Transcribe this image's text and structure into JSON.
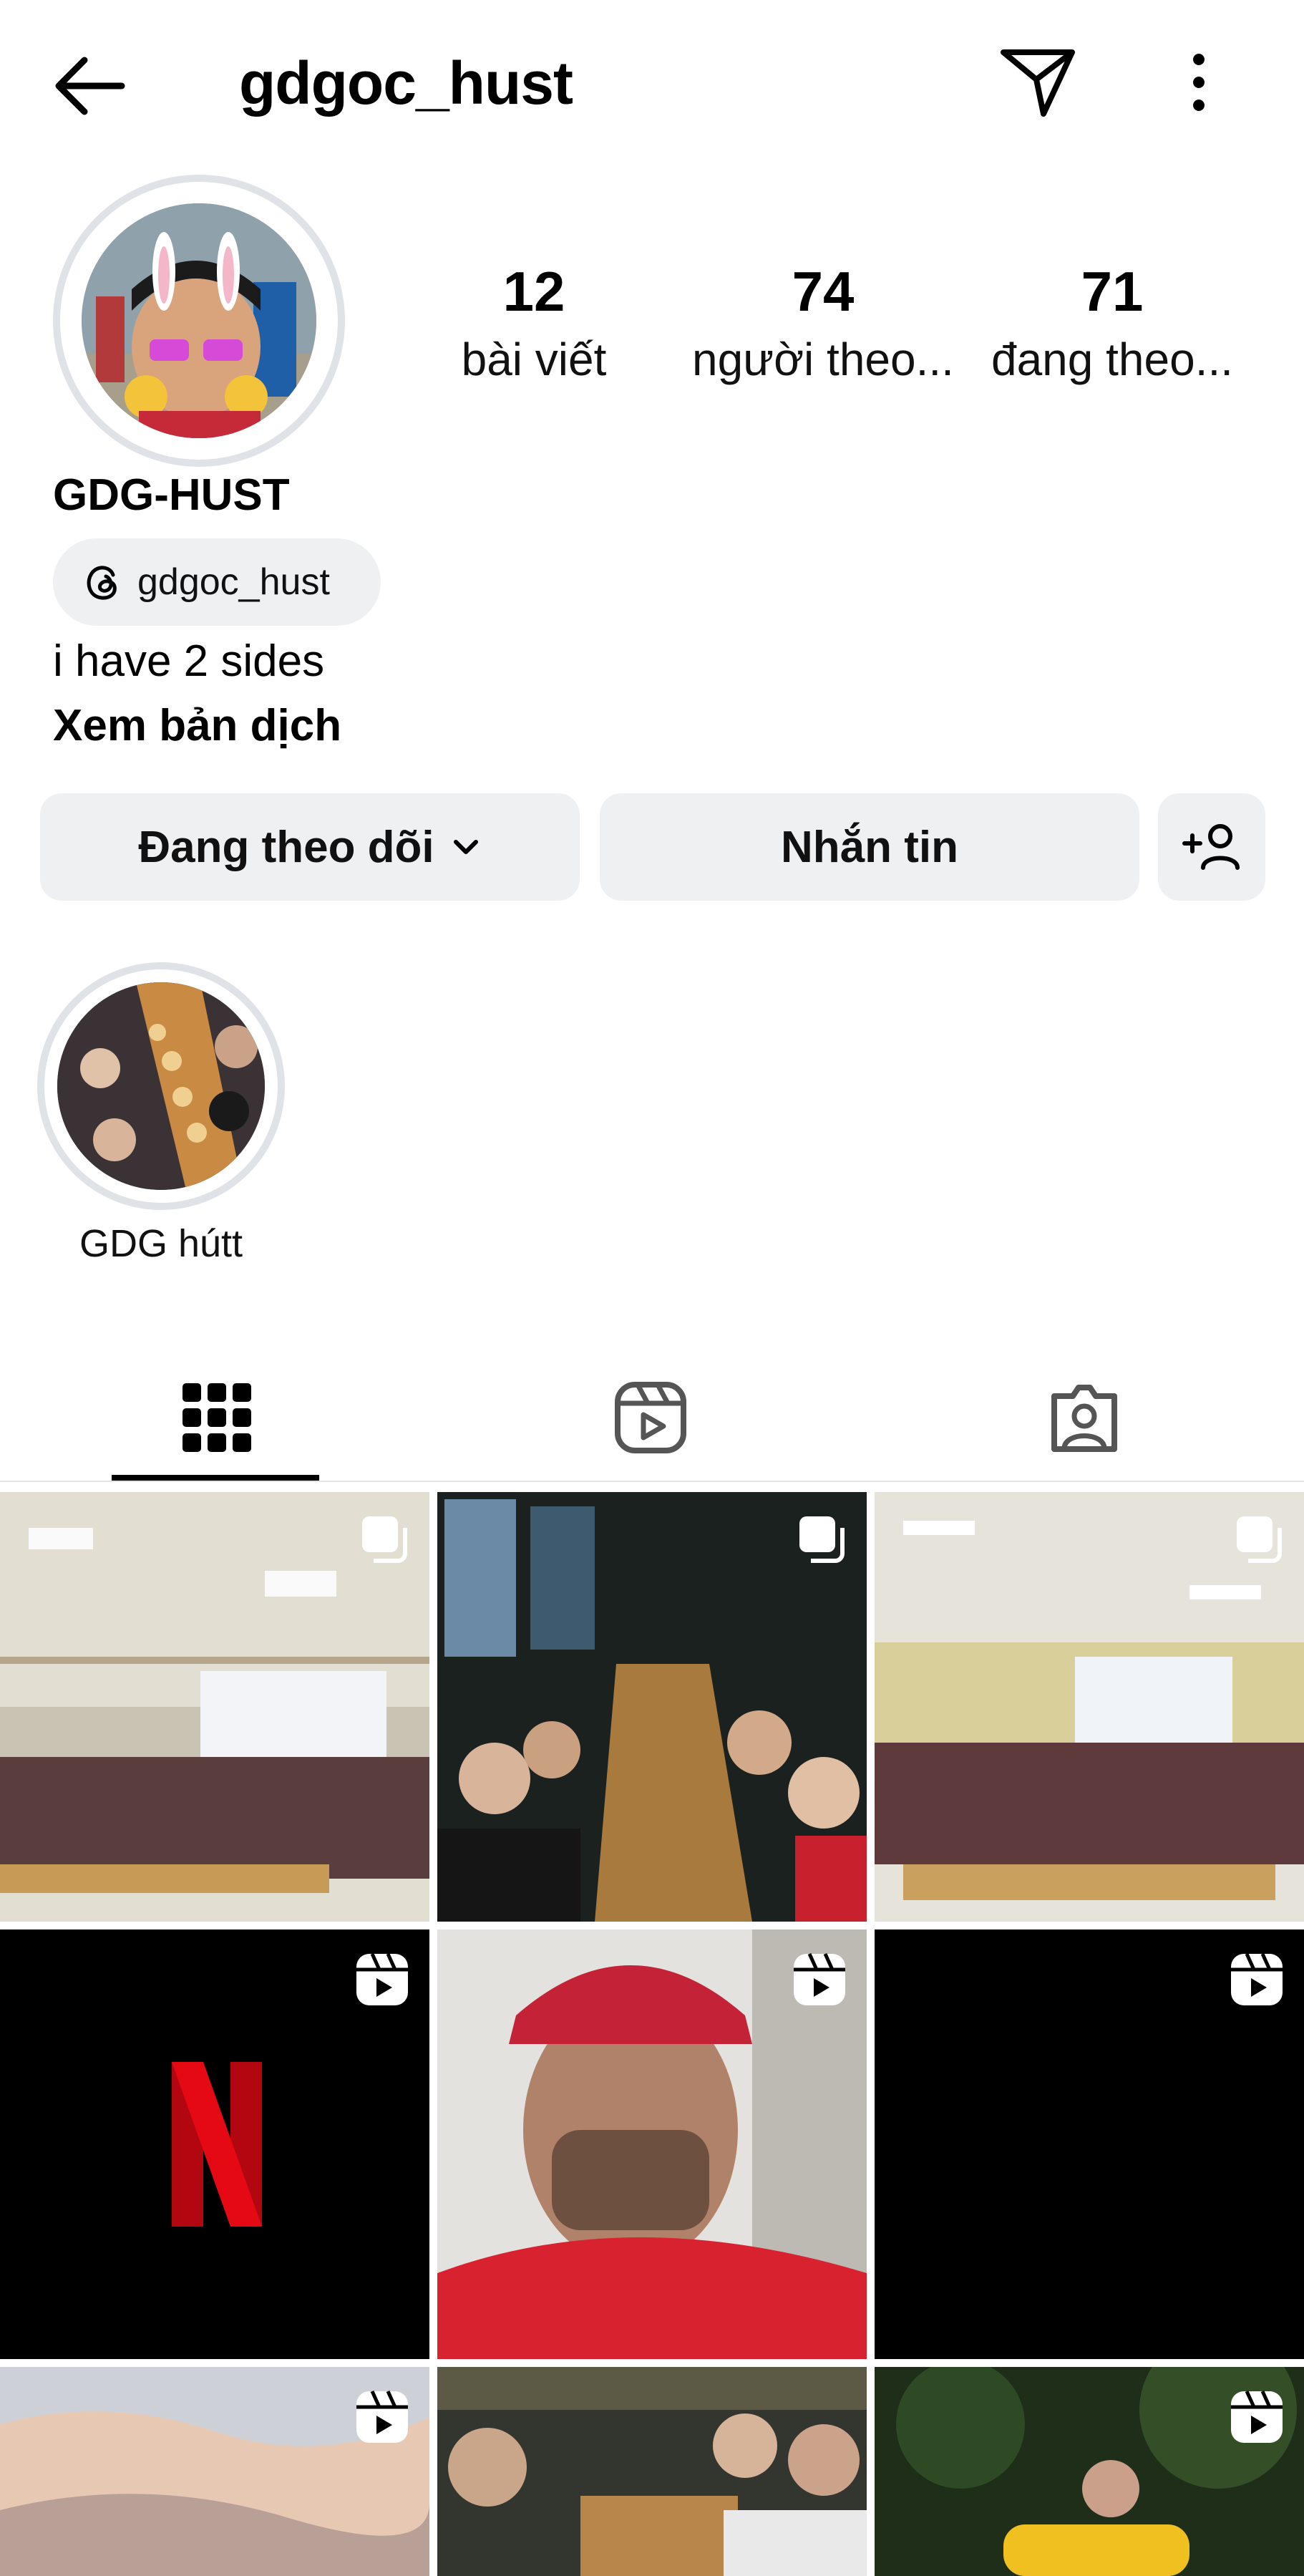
{
  "header": {
    "username": "gdgoc_hust"
  },
  "profile": {
    "stats": [
      {
        "value": "12",
        "label": "bài viết"
      },
      {
        "value": "74",
        "label": "người theo..."
      },
      {
        "value": "71",
        "label": "đang theo..."
      }
    ],
    "display_name": "GDG-HUST",
    "threads_handle": "gdgoc_hust",
    "bio": "i have 2 sides",
    "translate_link": "Xem bản dịch"
  },
  "actions": {
    "following_label": "Đang theo dõi",
    "message_label": "Nhắn tin"
  },
  "highlights": [
    {
      "label": "GDG hútt"
    }
  ],
  "tabs": [
    {
      "icon": "grid-icon",
      "active": true
    },
    {
      "icon": "reels-icon",
      "active": false
    },
    {
      "icon": "tagged-icon",
      "active": false
    }
  ],
  "grid": [
    {
      "type": "carousel"
    },
    {
      "type": "carousel"
    },
    {
      "type": "carousel"
    },
    {
      "type": "reel",
      "logo_text": "N"
    },
    {
      "type": "reel"
    },
    {
      "type": "reel"
    },
    {
      "type": "reel"
    },
    {
      "type": "reel"
    },
    {
      "type": "reel"
    }
  ],
  "colors": {
    "button_bg": "#eff0f2",
    "netflix_red": "#e50914",
    "ring": "#dfe3e7"
  }
}
